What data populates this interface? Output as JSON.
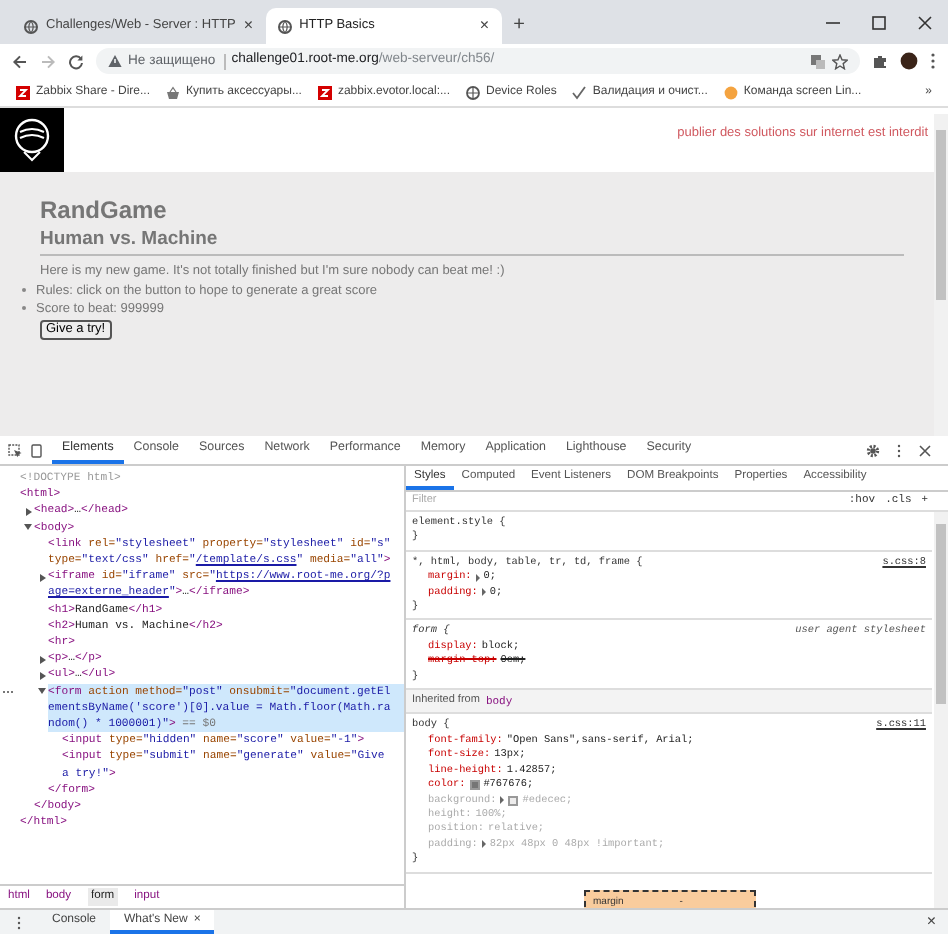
{
  "browser": {
    "tabs": [
      {
        "title": "Challenges/Web - Server : HTTP",
        "close": "×",
        "selected": false
      },
      {
        "title": "HTTP Basics",
        "close": "×",
        "selected": true
      }
    ],
    "new_tab": "+",
    "address": {
      "security": "Не защищено",
      "host": "challenge01.root-me.org",
      "path": "/web-serveur/ch56/"
    },
    "bookmarks": [
      {
        "kind": "zabbix",
        "label": "Zabbix Share - Dire..."
      },
      {
        "kind": "basket",
        "label": "Купить аксессуары..."
      },
      {
        "kind": "zabbix",
        "label": "zabbix.evotor.local:..."
      },
      {
        "kind": "globe",
        "label": "Device Roles"
      },
      {
        "kind": "check",
        "label": "Валидация и очист..."
      },
      {
        "kind": "orange",
        "label": "Команда screen Lin..."
      }
    ],
    "more_bookmarks": "»"
  },
  "page": {
    "banner": "publier des solutions sur internet est interdit",
    "heading": "RandGame",
    "subheading": "Human vs. Machine",
    "intro": "Here is my new game. It's not totally finished but I'm sure nobody can beat me! :)",
    "list": [
      "Rules: click on the button to hope to generate a great score",
      "Score to beat: 999999"
    ],
    "button": "Give a try!"
  },
  "devtools": {
    "tabs": [
      {
        "label": "Elements",
        "selected": true
      },
      {
        "label": "Console",
        "selected": false
      },
      {
        "label": "Sources",
        "selected": false
      },
      {
        "label": "Network",
        "selected": false
      },
      {
        "label": "Performance",
        "selected": false
      },
      {
        "label": "Memory",
        "selected": false
      },
      {
        "label": "Application",
        "selected": false
      },
      {
        "label": "Lighthouse",
        "selected": false
      },
      {
        "label": "Security",
        "selected": false
      }
    ],
    "dom": [
      {
        "selected": false,
        "tokens": [
          {
            "kind": "doctype",
            "text": "<!DOCTYPE html>"
          }
        ]
      },
      {
        "selected": false,
        "tokens": [
          {
            "kind": "tag",
            "text": "<html>"
          }
        ],
        "children": [
          {
            "expanded": false,
            "selected": false,
            "tokens": [
              {
                "kind": "tag",
                "text": "<head>"
              },
              {
                "kind": "text",
                "text": "…"
              },
              {
                "kind": "tag",
                "text": "</head>"
              }
            ]
          },
          {
            "expanded": true,
            "selected": false,
            "tokens": [
              {
                "kind": "tag",
                "text": "<body>"
              }
            ],
            "children": [
              {
                "selected": false,
                "tokens": [
                  {
                    "kind": "tag",
                    "text": "<link"
                  },
                  {
                    "kind": "attr",
                    "text": " rel="
                  },
                  {
                    "kind": "value",
                    "text": "\"stylesheet\""
                  },
                  {
                    "kind": "attr",
                    "text": " property="
                  },
                  {
                    "kind": "value",
                    "text": "\"stylesheet\""
                  },
                  {
                    "kind": "attr",
                    "text": " id="
                  },
                  {
                    "kind": "value",
                    "text": "\"s\""
                  },
                  {
                    "kind": "attr",
                    "text": " type="
                  },
                  {
                    "kind": "value",
                    "text": "\"text/css\""
                  },
                  {
                    "kind": "attr",
                    "text": " href="
                  },
                  {
                    "kind": "value",
                    "text": "\""
                  },
                  {
                    "kind": "link",
                    "text": "/template/s.css"
                  },
                  {
                    "kind": "value",
                    "text": "\""
                  },
                  {
                    "kind": "attr",
                    "text": " media="
                  },
                  {
                    "kind": "value",
                    "text": "\"all\""
                  },
                  {
                    "kind": "tag",
                    "text": ">"
                  }
                ]
              },
              {
                "expanded": false,
                "selected": false,
                "tokens": [
                  {
                    "kind": "tag",
                    "text": "<iframe"
                  },
                  {
                    "kind": "attr",
                    "text": " id="
                  },
                  {
                    "kind": "value",
                    "text": "\"iframe\""
                  },
                  {
                    "kind": "attr",
                    "text": " src="
                  },
                  {
                    "kind": "value",
                    "text": "\""
                  },
                  {
                    "kind": "link",
                    "text": "https://www.root-me.org/?page=externe_header"
                  },
                  {
                    "kind": "value",
                    "text": "\""
                  },
                  {
                    "kind": "tag",
                    "text": ">"
                  },
                  {
                    "kind": "text",
                    "text": "…"
                  },
                  {
                    "kind": "tag",
                    "text": "</iframe>"
                  }
                ]
              },
              {
                "selected": false,
                "tokens": [
                  {
                    "kind": "tag",
                    "text": "<h1>"
                  },
                  {
                    "kind": "text",
                    "text": "RandGame"
                  },
                  {
                    "kind": "tag",
                    "text": "</h1>"
                  }
                ]
              },
              {
                "selected": false,
                "tokens": [
                  {
                    "kind": "tag",
                    "text": "<h2>"
                  },
                  {
                    "kind": "text",
                    "text": "Human vs. Machine"
                  },
                  {
                    "kind": "tag",
                    "text": "</h2>"
                  }
                ]
              },
              {
                "selected": false,
                "tokens": [
                  {
                    "kind": "tag",
                    "text": "<hr>"
                  }
                ]
              },
              {
                "expanded": false,
                "selected": false,
                "tokens": [
                  {
                    "kind": "tag",
                    "text": "<p>"
                  },
                  {
                    "kind": "text",
                    "text": "…"
                  },
                  {
                    "kind": "tag",
                    "text": "</p>"
                  }
                ]
              },
              {
                "expanded": false,
                "selected": false,
                "tokens": [
                  {
                    "kind": "tag",
                    "text": "<ul>"
                  },
                  {
                    "kind": "text",
                    "text": "…"
                  },
                  {
                    "kind": "tag",
                    "text": "</ul>"
                  }
                ]
              },
              {
                "expanded": true,
                "selected": true,
                "tokens": [
                  {
                    "kind": "tag",
                    "text": "<form"
                  },
                  {
                    "kind": "attr",
                    "text": " action method="
                  },
                  {
                    "kind": "value",
                    "text": "\"post\""
                  },
                  {
                    "kind": "attr",
                    "text": " onsubmit="
                  },
                  {
                    "kind": "value",
                    "text": "\"document.getElementsByName('score')[0].value = Math.floor(Math.random() * 1000001)\""
                  },
                  {
                    "kind": "tag",
                    "text": ">"
                  },
                  {
                    "kind": "marker",
                    "text": " == $0"
                  }
                ],
                "children": [
                  {
                    "selected": false,
                    "tokens": [
                      {
                        "kind": "tag",
                        "text": "<input"
                      },
                      {
                        "kind": "attr",
                        "text": " type="
                      },
                      {
                        "kind": "value",
                        "text": "\"hidden\""
                      },
                      {
                        "kind": "attr",
                        "text": " name="
                      },
                      {
                        "kind": "value",
                        "text": "\"score\""
                      },
                      {
                        "kind": "attr",
                        "text": " value="
                      },
                      {
                        "kind": "value",
                        "text": "\"-1\""
                      },
                      {
                        "kind": "tag",
                        "text": ">"
                      }
                    ]
                  },
                  {
                    "selected": false,
                    "tokens": [
                      {
                        "kind": "tag",
                        "text": "<input"
                      },
                      {
                        "kind": "attr",
                        "text": " type="
                      },
                      {
                        "kind": "value",
                        "text": "\"submit\""
                      },
                      {
                        "kind": "attr",
                        "text": " name="
                      },
                      {
                        "kind": "value",
                        "text": "\"generate\""
                      },
                      {
                        "kind": "attr",
                        "text": " value="
                      },
                      {
                        "kind": "value",
                        "text": "\"Give a try!\""
                      },
                      {
                        "kind": "tag",
                        "text": ">"
                      }
                    ]
                  }
                ],
                "close": [
                  {
                    "kind": "tag",
                    "text": "</form>"
                  }
                ]
              }
            ],
            "close": [
              {
                "kind": "tag",
                "text": "</body>"
              }
            ]
          }
        ],
        "close": [
          {
            "kind": "tag",
            "text": "</html>"
          }
        ]
      }
    ],
    "breadcrumbs": [
      {
        "label": "html",
        "selected": false
      },
      {
        "label": "body",
        "selected": false
      },
      {
        "label": "form",
        "selected": true
      },
      {
        "label": "input",
        "selected": false
      }
    ],
    "styles_tabs": [
      {
        "label": "Styles",
        "selected": true
      },
      {
        "label": "Computed",
        "selected": false
      },
      {
        "label": "Event Listeners",
        "selected": false
      },
      {
        "label": "DOM Breakpoints",
        "selected": false
      },
      {
        "label": "Properties",
        "selected": false
      },
      {
        "label": "Accessibility",
        "selected": false
      }
    ],
    "filter": {
      "placeholder": "Filter",
      "hov": ":hov",
      "cls": ".cls",
      "add": "+"
    },
    "rules": [
      {
        "kind": "rule",
        "selector": "element.style {",
        "user_agent": false,
        "close": "}"
      },
      {
        "kind": "rule",
        "selector": "*, html, body, table, tr, td, frame {",
        "source": "s.css:8",
        "user_agent": false,
        "close": "}",
        "declarations": [
          {
            "property": "margin:",
            "value": "0;",
            "expandable": true,
            "overridden": false,
            "inactive": false
          },
          {
            "property": "padding:",
            "value": "0;",
            "expandable": true,
            "overridden": false,
            "inactive": false
          }
        ]
      },
      {
        "kind": "rule",
        "selector": "form {",
        "source": "user agent stylesheet",
        "user_agent": true,
        "close": "}",
        "declarations": [
          {
            "property": "display:",
            "value": "block;",
            "expandable": false,
            "overridden": false,
            "inactive": false
          },
          {
            "property": "margin-top:",
            "value": "0em;",
            "expandable": false,
            "overridden": true,
            "inactive": false
          }
        ]
      },
      {
        "kind": "inherited",
        "label": "Inherited from",
        "element": "body"
      },
      {
        "kind": "rule",
        "selector": "body {",
        "source": "s.css:11",
        "user_agent": false,
        "close": "}",
        "declarations": [
          {
            "property": "font-family:",
            "value": "\"Open Sans\",sans-serif, Arial;",
            "expandable": false,
            "overridden": false,
            "inactive": false
          },
          {
            "property": "font-size:",
            "value": "13px;",
            "expandable": false,
            "overridden": false,
            "inactive": false
          },
          {
            "property": "line-height:",
            "value": "1.42857;",
            "expandable": false,
            "overridden": false,
            "inactive": false
          },
          {
            "property": "color:",
            "value": "#767676;",
            "color": "#767676",
            "expandable": false,
            "overridden": false,
            "inactive": false
          },
          {
            "property": "background:",
            "value": "#edecec;",
            "color": "#edecec",
            "expandable": true,
            "overridden": false,
            "inactive": true
          },
          {
            "property": "height:",
            "value": "100%;",
            "expandable": false,
            "overridden": false,
            "inactive": true
          },
          {
            "property": "position:",
            "value": "relative;",
            "expandable": false,
            "overridden": false,
            "inactive": true
          },
          {
            "property": "padding:",
            "value": "82px 48px 0 48px !important;",
            "expandable": true,
            "overridden": false,
            "inactive": true
          }
        ]
      }
    ],
    "box_model": {
      "label": "margin",
      "value": "-"
    },
    "drawer": {
      "tabs": [
        {
          "label": "Console",
          "selected": false
        },
        {
          "label": "What's New",
          "close": "×",
          "selected": true
        }
      ],
      "close": "×"
    }
  }
}
